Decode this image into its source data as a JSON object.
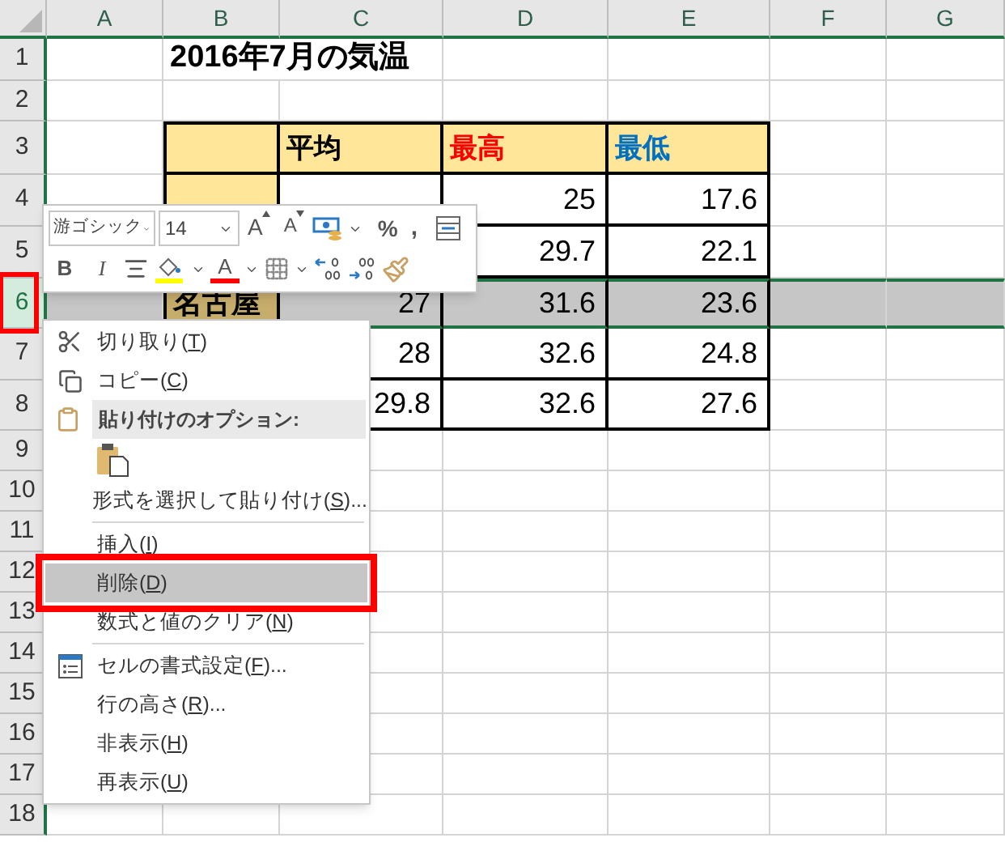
{
  "column_headers": [
    "A",
    "B",
    "C",
    "D",
    "E",
    "F",
    "G"
  ],
  "row_headers": [
    {
      "label": "1",
      "selected": false,
      "annotated": false
    },
    {
      "label": "2",
      "selected": false,
      "annotated": false
    },
    {
      "label": "3",
      "selected": false,
      "annotated": false
    },
    {
      "label": "4",
      "selected": false,
      "annotated": false
    },
    {
      "label": "5",
      "selected": false,
      "annotated": false
    },
    {
      "label": "6",
      "selected": true,
      "annotated": true
    },
    {
      "label": "7",
      "selected": false,
      "annotated": false
    },
    {
      "label": "8",
      "selected": false,
      "annotated": false
    },
    {
      "label": "9",
      "selected": false,
      "annotated": false
    },
    {
      "label": "10",
      "selected": false,
      "annotated": false
    },
    {
      "label": "11",
      "selected": false,
      "annotated": false
    },
    {
      "label": "12",
      "selected": false,
      "annotated": false
    },
    {
      "label": "13",
      "selected": false,
      "annotated": false
    },
    {
      "label": "14",
      "selected": false,
      "annotated": false
    },
    {
      "label": "15",
      "selected": false,
      "annotated": false
    },
    {
      "label": "16",
      "selected": false,
      "annotated": false
    },
    {
      "label": "17",
      "selected": false,
      "annotated": false
    },
    {
      "label": "18",
      "selected": false,
      "annotated": false
    }
  ],
  "title": "2016年7月の気温",
  "table": {
    "columns": [
      {
        "label": "平均",
        "color": "#000000"
      },
      {
        "label": "最高",
        "color": "#ff0000"
      },
      {
        "label": "最低",
        "color": "#0070c0"
      }
    ],
    "rows": [
      {
        "high": "25",
        "low": "17.6"
      },
      {
        "high": "29.7",
        "low": "22.1"
      },
      {
        "city": "名古屋",
        "avg": "27",
        "high": "31.6",
        "low": "23.6"
      },
      {
        "avg": "28",
        "high": "32.6",
        "low": "24.8"
      },
      {
        "avg": "29.8",
        "high": "32.6",
        "low": "27.6"
      }
    ]
  },
  "mini_toolbar": {
    "font_name": "游ゴシック",
    "font_size": "14",
    "grow_label": "A",
    "shrink_label": "A",
    "percent_label": "%",
    "comma_label": ",",
    "bold_label": "B",
    "italic_label": "I",
    "font_color_label": "A"
  },
  "context_menu": [
    {
      "kind": "command",
      "text": "切り取り(",
      "accel": "T",
      "tail": ")",
      "selected": false,
      "annotated": false
    },
    {
      "kind": "command",
      "text": "コピー(",
      "accel": "C",
      "tail": ")",
      "selected": false,
      "annotated": false
    },
    {
      "kind": "header",
      "text": "貼り付けのオプション:"
    },
    {
      "kind": "paste-options"
    },
    {
      "kind": "command",
      "text": "形式を選択して貼り付け(",
      "accel": "S",
      "tail": ")...",
      "selected": false,
      "annotated": false
    },
    {
      "kind": "separator"
    },
    {
      "kind": "command",
      "text": "挿入(",
      "accel": "I",
      "tail": ")",
      "selected": false,
      "annotated": false
    },
    {
      "kind": "command",
      "text": "削除(",
      "accel": "D",
      "tail": ")",
      "selected": true,
      "annotated": true
    },
    {
      "kind": "command",
      "text": "数式と値のクリア(",
      "accel": "N",
      "tail": ")",
      "selected": false,
      "annotated": false
    },
    {
      "kind": "separator"
    },
    {
      "kind": "command",
      "text": "セルの書式設定(",
      "accel": "F",
      "tail": ")...",
      "selected": false,
      "annotated": false
    },
    {
      "kind": "command",
      "text": "行の高さ(",
      "accel": "R",
      "tail": ")...",
      "selected": false,
      "annotated": false
    },
    {
      "kind": "command",
      "text": "非表示(",
      "accel": "H",
      "tail": ")",
      "selected": false,
      "annotated": false
    },
    {
      "kind": "command",
      "text": "再表示(",
      "accel": "U",
      "tail": ")",
      "selected": false,
      "annotated": false
    }
  ]
}
